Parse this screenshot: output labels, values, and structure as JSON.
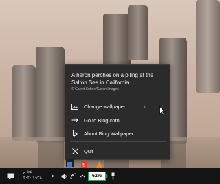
{
  "wallpaper_menu": {
    "caption": "A heron perches on a piling at the Salton Sea in California",
    "credit": "© Garret Suhrie/Cavan Images",
    "items": [
      {
        "label": "Change wallpaper",
        "icon": "image-icon"
      },
      {
        "label": "Go to Bing.com",
        "icon": "arrow-right-icon"
      },
      {
        "label": "About Bing Wallpaper",
        "icon": "bing-logo-icon"
      },
      {
        "label": "Quit",
        "icon": "close-icon"
      }
    ],
    "prev_symbol": "‹",
    "next_symbol": "›"
  },
  "taskbar": {
    "clock_time": "٥:٤٠ م",
    "clock_date": "٢٠٢٠/١٠/٢٨",
    "language": "ع",
    "battery_percent": "62%"
  },
  "colors": {
    "menu_bg": "#2b2b2b",
    "battery_accent": "#1fa84a",
    "taskbar_bg": "#141414"
  }
}
